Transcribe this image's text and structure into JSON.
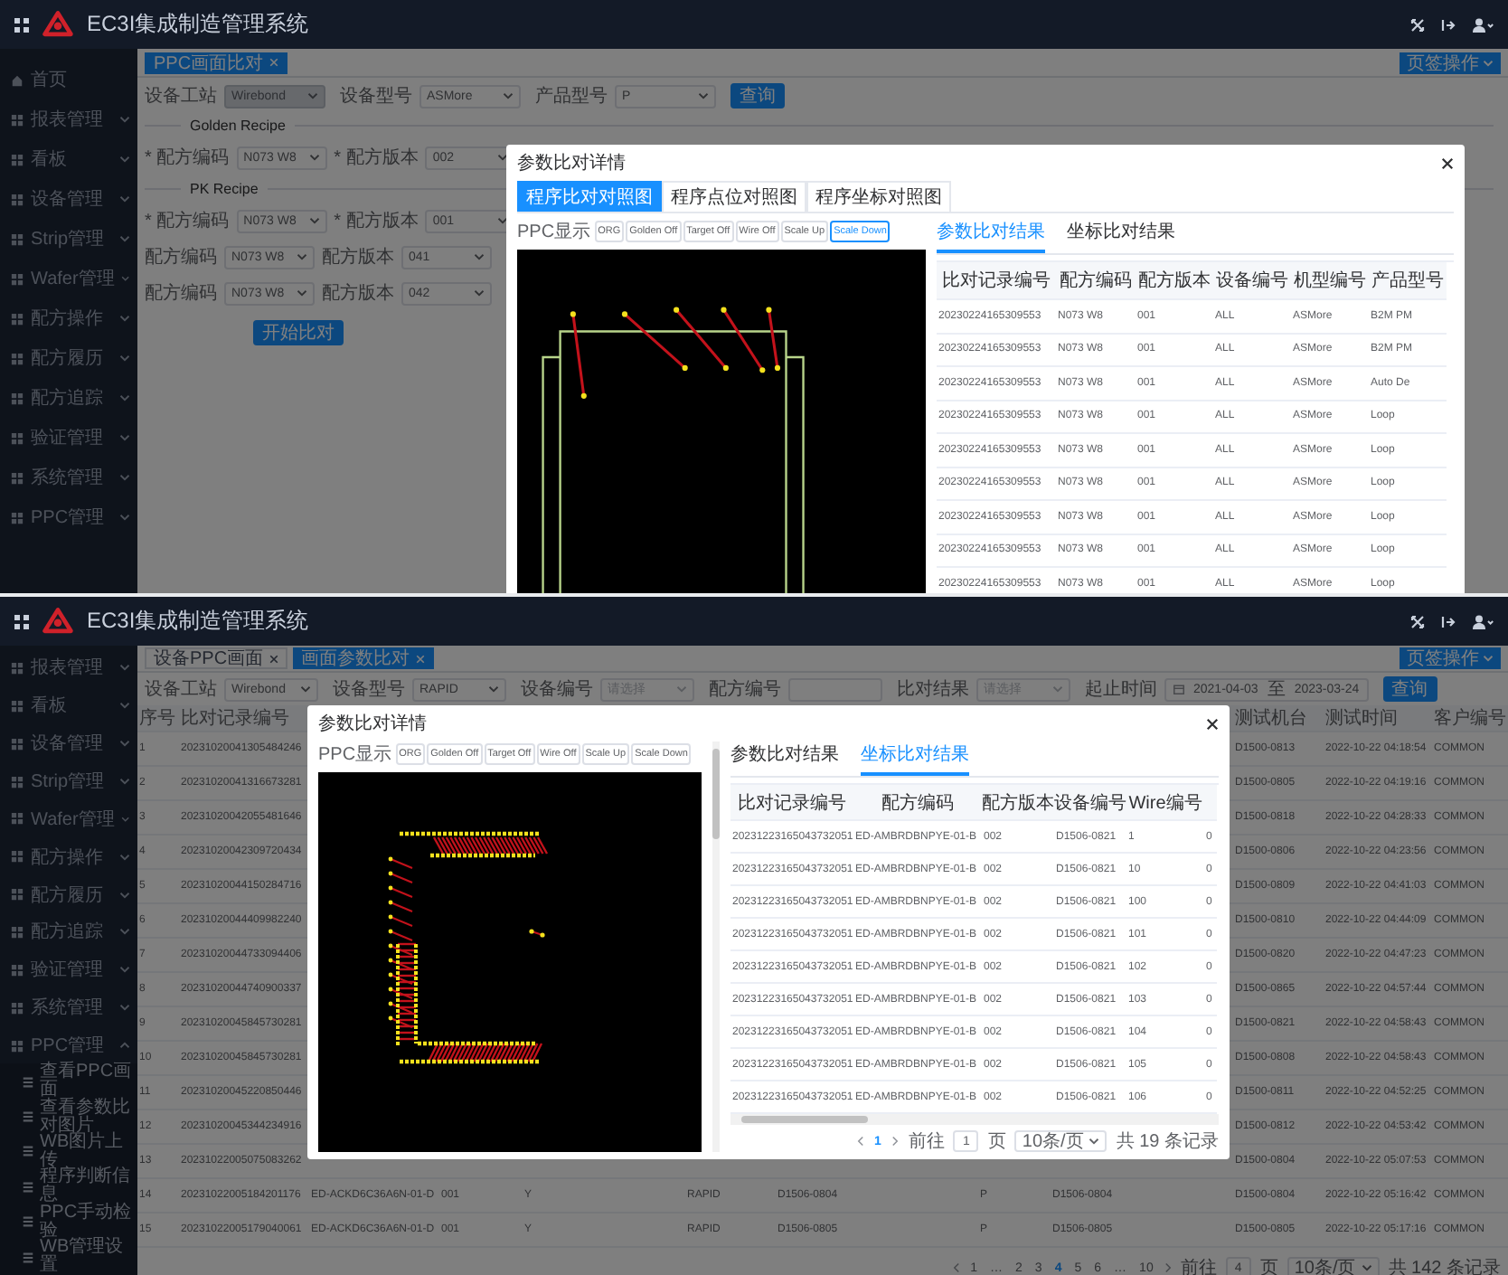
{
  "upper_screen": {
    "header": {
      "title": "EC3I集成制造管理系统"
    },
    "sidebar": [
      {
        "label": "首页",
        "kind": "link"
      },
      {
        "label": "报表管理",
        "kind": "menu",
        "expanded": false
      },
      {
        "label": "看板",
        "kind": "menu",
        "expanded": false
      },
      {
        "label": "设备管理",
        "kind": "menu",
        "expanded": false
      },
      {
        "label": "Strip管理",
        "kind": "menu",
        "expanded": false
      },
      {
        "label": "Wafer管理",
        "kind": "menu",
        "expanded": false
      },
      {
        "label": "配方操作",
        "kind": "menu",
        "expanded": false
      },
      {
        "label": "配方履历",
        "kind": "menu",
        "expanded": false
      },
      {
        "label": "配方追踪",
        "kind": "menu",
        "expanded": false
      },
      {
        "label": "验证管理",
        "kind": "menu",
        "expanded": false
      },
      {
        "label": "系统管理",
        "kind": "menu",
        "expanded": false
      },
      {
        "label": "PPC管理",
        "kind": "menu",
        "expanded": false
      }
    ],
    "tags": [
      {
        "label": "PPC画面比对",
        "selected": true
      }
    ],
    "tag_menu": "页签操作",
    "filters": [
      {
        "kind": "select",
        "label": "设备工站",
        "value": "Wirebond",
        "disabled": true
      },
      {
        "kind": "select",
        "label": "设备型号",
        "value": "ASMore",
        "disabled": false
      },
      {
        "kind": "select",
        "label": "产品型号",
        "value": "P",
        "disabled": false
      }
    ],
    "search_button": "查询",
    "recipe_groups": [
      {
        "title": "Golden Recipe",
        "rows": [
          [
            {
              "label": "* 配方编码",
              "value": "N073 W8"
            },
            {
              "label": "* 配方版本",
              "value": "002"
            }
          ]
        ]
      },
      {
        "title": "PK Recipe",
        "rows": [
          [
            {
              "label": "* 配方编码",
              "value": "N073 W8"
            },
            {
              "label": "* 配方版本",
              "value": "001"
            }
          ],
          [
            {
              "label": "配方编码",
              "value": "N073 W8"
            },
            {
              "label": "配方版本",
              "value": "041"
            }
          ],
          [
            {
              "label": "配方编码",
              "value": "N073 W8"
            },
            {
              "label": "配方版本",
              "value": "042"
            }
          ]
        ]
      }
    ],
    "compare_button": "开始比对",
    "modal": {
      "title": "参数比对详情",
      "view_tabs": [
        {
          "label": "程序比对对照图",
          "selected": true
        },
        {
          "label": "程序点位对照图",
          "selected": false
        },
        {
          "label": "程序坐标对照图",
          "selected": false
        }
      ],
      "toolbar_label": "PPC显示",
      "toolbar": [
        {
          "label": "ORG",
          "selected": false
        },
        {
          "label": "Golden Off",
          "selected": false
        },
        {
          "label": "Target Off",
          "selected": false
        },
        {
          "label": "Wire Off",
          "selected": false
        },
        {
          "label": "Scale Up",
          "selected": false
        },
        {
          "label": "Scale Down",
          "selected": true
        }
      ],
      "result_tabs": [
        {
          "label": "参数比对结果",
          "selected": true
        },
        {
          "label": "坐标比对结果",
          "selected": false
        }
      ],
      "table": {
        "columns": [
          "比对记录编号",
          "配方编码",
          "配方版本",
          "设备编号",
          "机型编号",
          "产品型号"
        ],
        "rows": [
          [
            "20230224165309553",
            "N073 W8",
            "001",
            "ALL",
            "ASMore",
            "B2M PM"
          ],
          [
            "20230224165309553",
            "N073 W8",
            "001",
            "ALL",
            "ASMore",
            "B2M PM"
          ],
          [
            "20230224165309553",
            "N073 W8",
            "001",
            "ALL",
            "ASMore",
            "Auto De"
          ],
          [
            "20230224165309553",
            "N073 W8",
            "001",
            "ALL",
            "ASMore",
            "Loop"
          ],
          [
            "20230224165309553",
            "N073 W8",
            "001",
            "ALL",
            "ASMore",
            "Loop"
          ],
          [
            "20230224165309553",
            "N073 W8",
            "001",
            "ALL",
            "ASMore",
            "Loop"
          ],
          [
            "20230224165309553",
            "N073 W8",
            "001",
            "ALL",
            "ASMore",
            "Loop"
          ],
          [
            "20230224165309553",
            "N073 W8",
            "001",
            "ALL",
            "ASMore",
            "Loop"
          ],
          [
            "20230224165309553",
            "N073 W8",
            "001",
            "ALL",
            "ASMore",
            "Loop"
          ]
        ]
      }
    }
  },
  "lower_screen": {
    "header": {
      "title": "EC3I集成制造管理系统"
    },
    "sidebar": [
      {
        "label": "报表管理",
        "kind": "menu",
        "expanded": false
      },
      {
        "label": "看板",
        "kind": "menu",
        "expanded": false
      },
      {
        "label": "设备管理",
        "kind": "menu",
        "expanded": false
      },
      {
        "label": "Strip管理",
        "kind": "menu",
        "expanded": false
      },
      {
        "label": "Wafer管理",
        "kind": "menu",
        "expanded": false
      },
      {
        "label": "配方操作",
        "kind": "menu",
        "expanded": false
      },
      {
        "label": "配方履历",
        "kind": "menu",
        "expanded": false
      },
      {
        "label": "配方追踪",
        "kind": "menu",
        "expanded": false
      },
      {
        "label": "验证管理",
        "kind": "menu",
        "expanded": false
      },
      {
        "label": "系统管理",
        "kind": "menu",
        "expanded": false
      },
      {
        "label": "PPC管理",
        "kind": "menu",
        "expanded": true,
        "children": [
          {
            "label": "查看PPC画面"
          },
          {
            "label": "查看参数比对图片"
          },
          {
            "label": "WB图片上传"
          },
          {
            "label": "程序判断信息"
          },
          {
            "label": "PPC手动检验"
          },
          {
            "label": "WB管理设置"
          }
        ]
      }
    ],
    "tags": [
      {
        "label": "设备PPC画面",
        "selected": false
      },
      {
        "label": "画面参数比对",
        "selected": true
      }
    ],
    "tag_menu": "页签操作",
    "filters": [
      {
        "kind": "select",
        "label": "设备工站",
        "value": "Wirebond"
      },
      {
        "kind": "select",
        "label": "设备型号",
        "value": "RAPID"
      },
      {
        "kind": "select",
        "label": "设备编号",
        "placeholder": "请选择"
      },
      {
        "kind": "input",
        "label": "配方编号"
      },
      {
        "kind": "select",
        "label": "比对结果",
        "placeholder": "请选择"
      },
      {
        "kind": "daterange",
        "label": "起止时间",
        "start": "2021-04-03",
        "separator": "至",
        "end": "2023-03-24"
      }
    ],
    "search_button": "查询",
    "table": {
      "columns": {
        "no": "序号",
        "record_id": "比对记录编号",
        "machine": "测试机台",
        "time": "测试时间",
        "customer": "客户编号"
      },
      "rows": [
        {
          "no": "1",
          "record_id": "20231020041305484246",
          "machine": "D1500-0813",
          "time": "2022-10-22 04:18:54",
          "customer": "COMMON"
        },
        {
          "no": "2",
          "record_id": "20231020041316673281",
          "machine": "D1500-0805",
          "time": "2022-10-22 04:19:16",
          "customer": "COMMON"
        },
        {
          "no": "3",
          "record_id": "20231020042055481646",
          "machine": "D1500-0818",
          "time": "2022-10-22 04:28:33",
          "customer": "COMMON"
        },
        {
          "no": "4",
          "record_id": "20231020042309720434",
          "machine": "D1500-0806",
          "time": "2022-10-22 04:23:56",
          "customer": "COMMON"
        },
        {
          "no": "5",
          "record_id": "20231020044150284716",
          "machine": "D1500-0809",
          "time": "2022-10-22 04:41:03",
          "customer": "COMMON"
        },
        {
          "no": "6",
          "record_id": "20231020044409982240",
          "machine": "D1500-0810",
          "time": "2022-10-22 04:44:09",
          "customer": "COMMON"
        },
        {
          "no": "7",
          "record_id": "20231020044733094406",
          "machine": "D1500-0820",
          "time": "2022-10-22 04:47:23",
          "customer": "COMMON"
        },
        {
          "no": "8",
          "record_id": "20231020044740900337",
          "machine": "D1500-0865",
          "time": "2022-10-22 04:57:44",
          "customer": "COMMON"
        },
        {
          "no": "9",
          "record_id": "20231020045845730281",
          "machine": "D1500-0821",
          "time": "2022-10-22 04:58:43",
          "customer": "COMMON"
        },
        {
          "no": "10",
          "record_id": "20231020045845730281",
          "machine": "D1500-0808",
          "time": "2022-10-22 04:58:43",
          "customer": "COMMON"
        },
        {
          "no": "11",
          "record_id": "20231020045220850446",
          "machine": "D1500-0811",
          "time": "2022-10-22 04:52:25",
          "customer": "COMMON"
        },
        {
          "no": "12",
          "record_id": "20231020045344234916",
          "machine": "D1500-0812",
          "time": "2022-10-22 04:53:42",
          "customer": "COMMON"
        },
        {
          "no": "13",
          "record_id": "20231022005075083262",
          "machine": "D1500-0804",
          "time": "2022-10-22 05:07:53",
          "customer": "COMMON"
        },
        {
          "no": "14",
          "record_id": "20231022005184201176",
          "middle": {
            "recipe_code": "ED-ACKD6C36A6N-01-D",
            "recipe_version": "001",
            "flag": "Y",
            "device_model": "RAPID",
            "device_id": "D1506-0804",
            "product_model": "P",
            "column_11": "D1506-0804"
          },
          "machine": "D1500-0804",
          "time": "2022-10-22 05:16:42",
          "customer": "COMMON"
        },
        {
          "no": "15",
          "record_id": "20231022005179040061",
          "middle": {
            "recipe_code": "ED-ACKD6C36A6N-01-D",
            "recipe_version": "001",
            "flag": "Y",
            "device_model": "RAPID",
            "device_id": "D1506-0805",
            "product_model": "P",
            "column_11": "D1506-0805"
          },
          "machine": "D1500-0805",
          "time": "2022-10-22 05:17:16",
          "customer": "COMMON"
        }
      ]
    },
    "pagination": {
      "pages": [
        {
          "label": "1",
          "selected": false
        },
        {
          "label": "…",
          "selected": false
        },
        {
          "label": "2",
          "selected": false
        },
        {
          "label": "3",
          "selected": false
        },
        {
          "label": "4",
          "selected": true
        },
        {
          "label": "5",
          "selected": false
        },
        {
          "label": "6",
          "selected": false
        },
        {
          "label": "…",
          "selected": false
        },
        {
          "label": "10",
          "selected": false
        }
      ],
      "goto_label": "前往",
      "goto_value": "4",
      "page_unit": "页",
      "page_size": "10条/页",
      "total": "共 142 条记录"
    },
    "modal": {
      "title": "参数比对详情",
      "toolbar_label": "PPC显示",
      "toolbar": [
        {
          "label": "ORG",
          "selected": false
        },
        {
          "label": "Golden Off",
          "selected": false
        },
        {
          "label": "Target Off",
          "selected": false
        },
        {
          "label": "Wire Off",
          "selected": false
        },
        {
          "label": "Scale Up",
          "selected": false
        },
        {
          "label": "Scale Down",
          "selected": false
        }
      ],
      "result_tabs": [
        {
          "label": "参数比对结果",
          "selected": false
        },
        {
          "label": "坐标比对结果",
          "selected": true
        }
      ],
      "table": {
        "columns": [
          "比对记录编号",
          "配方编码",
          "配方版本",
          "设备编号",
          "Wire编号"
        ],
        "rows": [
          [
            "20231223165043732051",
            "ED-AMBRDBNPYE-01-B",
            "002",
            "D1506-0821",
            "1",
            "0"
          ],
          [
            "20231223165043732051",
            "ED-AMBRDBNPYE-01-B",
            "002",
            "D1506-0821",
            "10",
            "0"
          ],
          [
            "20231223165043732051",
            "ED-AMBRDBNPYE-01-B",
            "002",
            "D1506-0821",
            "100",
            "0"
          ],
          [
            "20231223165043732051",
            "ED-AMBRDBNPYE-01-B",
            "002",
            "D1506-0821",
            "101",
            "0"
          ],
          [
            "20231223165043732051",
            "ED-AMBRDBNPYE-01-B",
            "002",
            "D1506-0821",
            "102",
            "0"
          ],
          [
            "20231223165043732051",
            "ED-AMBRDBNPYE-01-B",
            "002",
            "D1506-0821",
            "103",
            "0"
          ],
          [
            "20231223165043732051",
            "ED-AMBRDBNPYE-01-B",
            "002",
            "D1506-0821",
            "104",
            "0"
          ],
          [
            "20231223165043732051",
            "ED-AMBRDBNPYE-01-B",
            "002",
            "D1506-0821",
            "105",
            "0"
          ],
          [
            "20231223165043732051",
            "ED-AMBRDBNPYE-01-B",
            "002",
            "D1506-0821",
            "106",
            "0"
          ]
        ]
      },
      "pagination": {
        "pages": [
          {
            "label": "1",
            "selected": true
          }
        ],
        "goto_label": "前往",
        "goto_value": "1",
        "page_unit": "页",
        "page_size": "10条/页",
        "total": "共 19 条记录"
      }
    }
  }
}
